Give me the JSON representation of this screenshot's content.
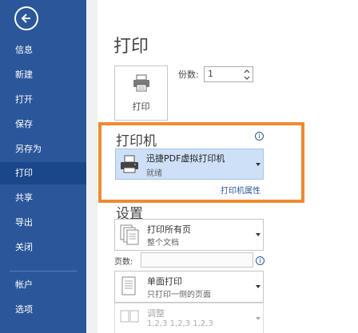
{
  "sidebar": {
    "items": [
      {
        "label": "信息",
        "id": "info"
      },
      {
        "label": "新建",
        "id": "new"
      },
      {
        "label": "打开",
        "id": "open"
      },
      {
        "label": "保存",
        "id": "save"
      },
      {
        "label": "另存为",
        "id": "save-as"
      },
      {
        "label": "打印",
        "id": "print",
        "active": true
      },
      {
        "label": "共享",
        "id": "share"
      },
      {
        "label": "导出",
        "id": "export"
      },
      {
        "label": "关闭",
        "id": "close"
      },
      {
        "label": "帐户",
        "id": "account"
      },
      {
        "label": "选项",
        "id": "options"
      }
    ]
  },
  "main": {
    "title": "打印",
    "print_button_label": "打印",
    "copies_label": "份数:",
    "copies_value": "1"
  },
  "printer": {
    "section_title": "打印机",
    "name": "迅捷PDF虚拟打印机",
    "status": "就绪",
    "properties_link": "打印机属性"
  },
  "settings": {
    "section_title": "设置",
    "range": {
      "main": "打印所有页",
      "sub": "整个文档"
    },
    "pages_label": "页数:",
    "sides": {
      "main": "单面打印",
      "sub": "只打印一侧的页面"
    },
    "collate": {
      "main": "调整",
      "sub": "1,2,3    1,2,3    1,2,3"
    }
  },
  "colors": {
    "sidebar": "#2b579a",
    "sidebar_active": "#19478a",
    "highlight_frame": "#f08a31",
    "printer_selected": "#cde0f7"
  },
  "icons": {
    "back": "back-arrow-icon",
    "print": "printer-icon",
    "info": "info-icon",
    "doc": "document-pages-icon"
  }
}
